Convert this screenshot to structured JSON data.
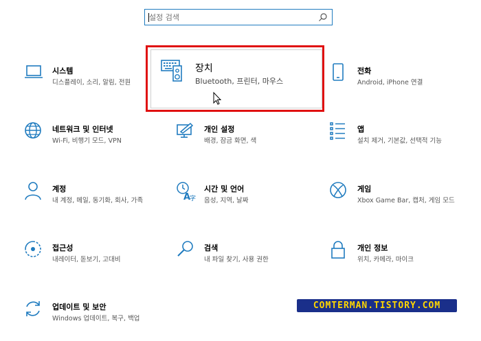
{
  "search": {
    "placeholder": "설정 검색"
  },
  "colors": {
    "accent": "#1f7bbf",
    "highlight": "#e01010",
    "watermark_bg": "#1a2f8a",
    "watermark_fg": "#ffd600"
  },
  "tiles": [
    {
      "title": "시스템",
      "desc": "디스플레이, 소리, 알림, 전원",
      "icon": "monitor-icon"
    },
    {
      "title": "장치",
      "desc": "Bluetooth, 프린터, 마우스",
      "icon": "devices-icon"
    },
    {
      "title": "전화",
      "desc": "Android, iPhone 연결",
      "icon": "phone-icon"
    },
    {
      "title": "네트워크 및 인터넷",
      "desc": "Wi-Fi, 비행기 모드, VPN",
      "icon": "globe-icon"
    },
    {
      "title": "개인 설정",
      "desc": "배경, 잠금 화면, 색",
      "icon": "personalization-icon"
    },
    {
      "title": "앱",
      "desc": "설치 제거, 기본값, 선택적 기능",
      "icon": "apps-list-icon"
    },
    {
      "title": "계정",
      "desc": "내 계정, 메일, 동기화, 회사, 가족",
      "icon": "person-icon"
    },
    {
      "title": "시간 및 언어",
      "desc": "음성, 지역, 날짜",
      "icon": "time-language-icon"
    },
    {
      "title": "게임",
      "desc": "Xbox Game Bar, 캡처, 게임 모드",
      "icon": "xbox-icon"
    },
    {
      "title": "접근성",
      "desc": "내레이터, 돋보기, 고대비",
      "icon": "accessibility-icon"
    },
    {
      "title": "검색",
      "desc": "내 파일 찾기, 사용 권한",
      "icon": "magnifier-icon"
    },
    {
      "title": "개인 정보",
      "desc": "위치, 카메라, 마이크",
      "icon": "lock-icon"
    },
    {
      "title": "업데이트 및 보안",
      "desc": "Windows 업데이트, 복구, 백업",
      "icon": "sync-icon"
    }
  ],
  "watermark": "COMTERMAN.TISTORY.COM"
}
